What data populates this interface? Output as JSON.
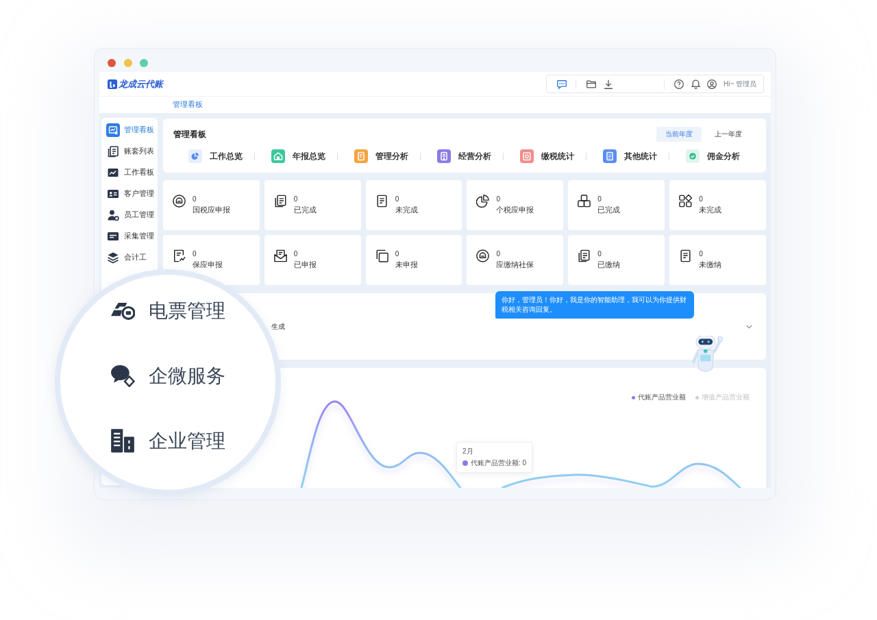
{
  "header": {
    "logo": "龙成云代账",
    "greeting": "Hi~ 管理员"
  },
  "page_tabs": [
    {
      "label": "管理看板",
      "selected": true
    }
  ],
  "sidebar": {
    "items": [
      {
        "label": "管理看板",
        "selected": true
      },
      {
        "label": "账套列表",
        "selected": false
      },
      {
        "label": "工作看板",
        "selected": false
      },
      {
        "label": "客户管理",
        "selected": false
      },
      {
        "label": "员工管理",
        "selected": false
      },
      {
        "label": "采集管理",
        "selected": false
      },
      {
        "label": "会计工",
        "selected": false
      }
    ]
  },
  "dashboard": {
    "title": "管理看板",
    "years": [
      {
        "label": "当前年度",
        "selected": true
      },
      {
        "label": "上一年度",
        "selected": false
      }
    ],
    "sections": [
      {
        "label": "工作总览",
        "kind": "soft",
        "color": "#5b8def"
      },
      {
        "label": "年报总览",
        "kind": "solid",
        "color": "#3cc89d"
      },
      {
        "label": "管理分析",
        "kind": "solid",
        "color": "#f5a440"
      },
      {
        "label": "经营分析",
        "kind": "solid",
        "color": "#8c7ae6"
      },
      {
        "label": "缴税统计",
        "kind": "solid",
        "color": "#f08d8a"
      },
      {
        "label": "其他统计",
        "kind": "solid",
        "color": "#5b8def"
      },
      {
        "label": "佣金分析",
        "kind": "soft",
        "color": "#2fbf8a"
      }
    ]
  },
  "stats": [
    {
      "value": "0",
      "label": "国税应申报"
    },
    {
      "value": "0",
      "label": "已完成"
    },
    {
      "value": "0",
      "label": "未完成"
    },
    {
      "value": "0",
      "label": "个税应申报"
    },
    {
      "value": "0",
      "label": "已完成"
    },
    {
      "value": "0",
      "label": "未完成"
    },
    {
      "value": "0",
      "label": "保应申报"
    },
    {
      "value": "0",
      "label": "已申报"
    },
    {
      "value": "0",
      "label": "未申报"
    },
    {
      "value": "0",
      "label": "应缴纳社保"
    },
    {
      "value": "0",
      "label": "已缴纳"
    },
    {
      "value": "0",
      "label": "未缴纳"
    }
  ],
  "summary_panel": {
    "text": "生成"
  },
  "assistant": {
    "message": "你好，管理员！你好，我是你的智能助理，我可以为你提供财税相关咨询回复。"
  },
  "chart": {
    "legend": [
      {
        "label": "代账产品营业额",
        "on": true
      },
      {
        "label": "增值产品营业额",
        "on": false
      }
    ],
    "tooltip": {
      "title": "2月",
      "text": "代账产品营业额: 0"
    }
  },
  "magnifier": {
    "items": [
      {
        "label": "电票管理"
      },
      {
        "label": "企微服务"
      },
      {
        "label": "企业管理"
      }
    ]
  }
}
